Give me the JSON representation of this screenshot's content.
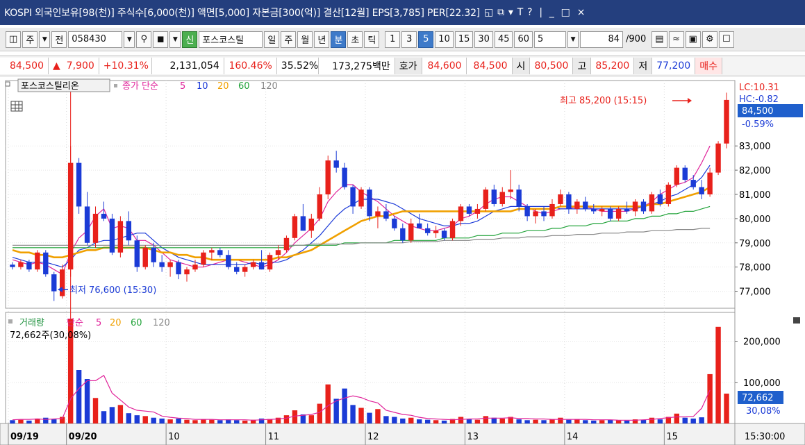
{
  "titlebar": {
    "title": "KOSPI 외국인보유[98(천)] 주식수[6,000(천)] 액면[5,000] 자본금[300(억)] 결산[12월] EPS[3,785] PER[22.32]",
    "icons": [
      "◱",
      "⧉",
      "▾",
      "T",
      "?"
    ],
    "win_buttons": [
      "|",
      "_",
      "□",
      "×"
    ]
  },
  "toolbar": {
    "market": "주",
    "period_mode": "전",
    "code": "058430",
    "name_tag": "신",
    "name": "포스코스틸",
    "periods": [
      "일",
      "주",
      "월",
      "년",
      "분",
      "초",
      "틱"
    ],
    "selected_period": "분",
    "intervals": [
      "1",
      "3",
      "5",
      "10",
      "15",
      "30",
      "45",
      "60"
    ],
    "selected_interval": "5",
    "interval_input": "5",
    "count": "84",
    "count_total": "/900"
  },
  "quote": {
    "price": "84,500",
    "change": "7,900",
    "change_pct": "+10.31%",
    "volume": "2,131,054",
    "volume_ratio": "160.46%",
    "turnover": "35.52%",
    "amount": "173,275백만",
    "bid_label": "호가",
    "bid": "84,600",
    "ask": "84,500",
    "open_label": "시",
    "open": "80,500",
    "high_label": "고",
    "high": "85,200",
    "low_label": "저",
    "low": "77,200",
    "buy_label": "매수"
  },
  "price_panel": {
    "stock_label": "포스코스틸리온",
    "ma_title": "종가 단순",
    "ma_periods": [
      "5",
      "10",
      "20",
      "60",
      "120"
    ],
    "ma_colors": [
      "#e0239a",
      "#1a39d8",
      "#f0a000",
      "#22a33a",
      "#888888"
    ],
    "lc": "LC:10.31",
    "hc": "HC:-0.82",
    "last_price": "84,500",
    "last_pct": "-0.59%",
    "y_ticks": [
      "83,000",
      "82,000",
      "81,000",
      "80,000",
      "79,000",
      "78,000",
      "77,000"
    ],
    "max_label": "최고 85,200 (15:15)",
    "min_label": "최저 76,600 (15:30)"
  },
  "volume_panel": {
    "title": "거래량",
    "ma_title": "단순",
    "ma_periods": [
      "5",
      "20",
      "60",
      "120"
    ],
    "info": "72,662주(30,08%)",
    "y_ticks": [
      "200,000",
      "100,000"
    ],
    "last_volume": "72,662",
    "last_pct": "30,08%"
  },
  "x_axis": {
    "labels": [
      "09/19",
      "09/20",
      "10",
      "11",
      "12",
      "13",
      "14",
      "15"
    ],
    "time": "15:30:00"
  },
  "chart_data": {
    "type": "candlestick",
    "up_color": "#e8211b",
    "down_color": "#1b3bd6",
    "price_range": [
      76300,
      85700
    ],
    "volume_range": [
      0,
      260000
    ],
    "sessions": [
      "09/19",
      "09/20",
      "10",
      "11",
      "12",
      "13",
      "14",
      "15"
    ],
    "ohlc": [
      [
        78100,
        78200,
        77900,
        78000
      ],
      [
        78000,
        78300,
        77900,
        78200
      ],
      [
        78200,
        78300,
        77800,
        77900
      ],
      [
        77900,
        78700,
        77800,
        78600
      ],
      [
        78600,
        78700,
        77600,
        77700
      ],
      [
        77700,
        77800,
        76600,
        77000
      ],
      [
        76800,
        78100,
        76700,
        77900
      ],
      [
        77900,
        83000,
        77600,
        82300
      ],
      [
        82300,
        82500,
        80200,
        80500
      ],
      [
        80500,
        81100,
        78900,
        79000
      ],
      [
        79000,
        80500,
        78800,
        80200
      ],
      [
        80200,
        80700,
        79900,
        80000
      ],
      [
        80000,
        80200,
        78500,
        78600
      ],
      [
        78600,
        80100,
        78400,
        79900
      ],
      [
        79900,
        80300,
        78900,
        79100
      ],
      [
        79100,
        79300,
        77800,
        78000
      ],
      [
        78000,
        78900,
        77900,
        78800
      ],
      [
        78800,
        79000,
        78000,
        78200
      ],
      [
        78200,
        78500,
        77800,
        78000
      ],
      [
        78000,
        78300,
        77600,
        78200
      ],
      [
        78200,
        78300,
        77500,
        77700
      ],
      [
        77700,
        78000,
        77400,
        77900
      ],
      [
        77900,
        78300,
        77800,
        78100
      ],
      [
        78100,
        78700,
        78000,
        78600
      ],
      [
        78600,
        78800,
        78300,
        78700
      ],
      [
        78700,
        78800,
        78400,
        78500
      ],
      [
        78500,
        78700,
        77900,
        78000
      ],
      [
        78000,
        78200,
        77700,
        77800
      ],
      [
        77800,
        78100,
        77600,
        78000
      ],
      [
        78000,
        78300,
        77900,
        78200
      ],
      [
        78200,
        78700,
        77900,
        77900
      ],
      [
        77900,
        78600,
        77800,
        78500
      ],
      [
        78500,
        78900,
        78300,
        78700
      ],
      [
        78700,
        79300,
        78600,
        79200
      ],
      [
        79200,
        80200,
        79100,
        80100
      ],
      [
        80100,
        80600,
        79500,
        79500
      ],
      [
        79500,
        80200,
        79200,
        80000
      ],
      [
        80000,
        81300,
        79900,
        81000
      ],
      [
        81000,
        82600,
        80800,
        82400
      ],
      [
        82400,
        82800,
        81900,
        82100
      ],
      [
        82100,
        82300,
        81200,
        81300
      ],
      [
        81300,
        81400,
        80200,
        80500
      ],
      [
        80500,
        81300,
        80400,
        81200
      ],
      [
        81200,
        81300,
        79900,
        80100
      ],
      [
        80100,
        80500,
        79600,
        80300
      ],
      [
        80300,
        80600,
        79900,
        80000
      ],
      [
        80000,
        80100,
        79500,
        79600
      ],
      [
        79600,
        79800,
        79000,
        79100
      ],
      [
        79100,
        80000,
        79000,
        79800
      ],
      [
        79800,
        80200,
        79600,
        79600
      ],
      [
        79600,
        79800,
        79300,
        79400
      ],
      [
        79400,
        79700,
        79200,
        79500
      ],
      [
        79500,
        79600,
        79100,
        79200
      ],
      [
        79200,
        80000,
        79100,
        79900
      ],
      [
        79900,
        80600,
        79700,
        80500
      ],
      [
        80500,
        80600,
        80100,
        80200
      ],
      [
        80200,
        80600,
        80000,
        80400
      ],
      [
        80400,
        81300,
        80300,
        81200
      ],
      [
        81200,
        81400,
        80500,
        80600
      ],
      [
        80600,
        81300,
        80500,
        81100
      ],
      [
        81100,
        82000,
        80800,
        81200
      ],
      [
        81200,
        81400,
        80300,
        80500
      ],
      [
        80500,
        80600,
        79900,
        80100
      ],
      [
        80100,
        80400,
        79800,
        80300
      ],
      [
        80300,
        80500,
        79900,
        80100
      ],
      [
        80100,
        80800,
        80000,
        80600
      ],
      [
        80600,
        81200,
        80500,
        81000
      ],
      [
        81000,
        81100,
        80200,
        80400
      ],
      [
        80400,
        80800,
        80200,
        80700
      ],
      [
        80700,
        80900,
        80300,
        80400
      ],
      [
        80400,
        80600,
        80200,
        80300
      ],
      [
        80300,
        80500,
        80100,
        80400
      ],
      [
        80400,
        80500,
        79900,
        80000
      ],
      [
        80000,
        80500,
        79900,
        80400
      ],
      [
        80400,
        80700,
        80200,
        80300
      ],
      [
        80300,
        80800,
        80100,
        80700
      ],
      [
        80700,
        80800,
        80200,
        80300
      ],
      [
        80300,
        81100,
        80200,
        81000
      ],
      [
        81000,
        81200,
        80500,
        80600
      ],
      [
        80600,
        81500,
        80500,
        81400
      ],
      [
        81400,
        82200,
        81300,
        82100
      ],
      [
        82100,
        82200,
        81500,
        81600
      ],
      [
        81600,
        81800,
        81200,
        81300
      ],
      [
        81300,
        81600,
        80800,
        81000
      ],
      [
        81000,
        82100,
        80900,
        81900
      ],
      [
        81900,
        83200,
        81800,
        83100
      ],
      [
        83100,
        85200,
        82900,
        84900
      ]
    ],
    "volume": [
      8000,
      9000,
      7000,
      12000,
      14000,
      10000,
      16000,
      255000,
      130000,
      108000,
      62000,
      30000,
      40000,
      45000,
      25000,
      20000,
      18000,
      14000,
      12000,
      10000,
      12000,
      9000,
      8000,
      10000,
      9000,
      8000,
      10000,
      8000,
      7000,
      9000,
      12000,
      11000,
      14000,
      20000,
      32000,
      22000,
      20000,
      48000,
      95000,
      60000,
      85000,
      45000,
      38000,
      26000,
      35000,
      18000,
      16000,
      12000,
      14000,
      10000,
      9000,
      8000,
      7000,
      11000,
      16000,
      10000,
      9000,
      18000,
      14000,
      12000,
      16000,
      10000,
      8000,
      9000,
      8000,
      10000,
      14000,
      9000,
      11000,
      8000,
      7000,
      8000,
      9000,
      8000,
      7000,
      10000,
      9000,
      14000,
      10000,
      16000,
      24000,
      14000,
      12000,
      15000,
      120000,
      235000,
      72662
    ],
    "ma_lines": {
      "5": [
        78300,
        78200,
        78100,
        78200,
        78100,
        77900,
        77700,
        78600,
        79200,
        79500,
        80100,
        80400,
        79600,
        79700,
        79600,
        79100,
        79100,
        78900,
        78600,
        78300,
        78200,
        78100,
        78000,
        78000,
        78100,
        78200,
        78300,
        78300,
        78200,
        78100,
        78000,
        78100,
        78300,
        78600,
        79000,
        79300,
        79600,
        80000,
        80700,
        81100,
        81400,
        81400,
        81100,
        80900,
        80700,
        80400,
        80100,
        79900,
        79700,
        79600,
        79500,
        79500,
        79600,
        79700,
        80000,
        80100,
        80300,
        80600,
        80800,
        80900,
        80900,
        80700,
        80500,
        80300,
        80200,
        80300,
        80400,
        80400,
        80500,
        80500,
        80400,
        80300,
        80300,
        80300,
        80300,
        80400,
        80500,
        80700,
        81000,
        81200,
        81400,
        81500,
        81700,
        82300,
        83000
      ],
      "10": [
        78400,
        78300,
        78200,
        78200,
        78200,
        78100,
        78000,
        78300,
        78700,
        78800,
        79000,
        79100,
        79100,
        79200,
        79300,
        79400,
        79400,
        79100,
        78800,
        78600,
        78400,
        78300,
        78200,
        78100,
        78100,
        78100,
        78100,
        78100,
        78100,
        78200,
        78100,
        78200,
        78200,
        78300,
        78500,
        78700,
        79000,
        79300,
        79700,
        80100,
        80400,
        80600,
        80800,
        80800,
        80800,
        80700,
        80600,
        80400,
        80200,
        80000,
        79900,
        79800,
        79700,
        79700,
        79800,
        79800,
        79900,
        80100,
        80300,
        80400,
        80500,
        80500,
        80500,
        80500,
        80500,
        80500,
        80400,
        80400,
        80400,
        80400,
        80400,
        80400,
        80400,
        80400,
        80400,
        80400,
        80500,
        80600,
        80700,
        80900,
        81000,
        81200,
        81400,
        81700,
        82200
      ],
      "20": [
        78700,
        78600,
        78600,
        78500,
        78500,
        78400,
        78400,
        78500,
        78600,
        78700,
        78700,
        78800,
        78800,
        78800,
        78800,
        78800,
        78800,
        78700,
        78600,
        78600,
        78500,
        78500,
        78400,
        78400,
        78300,
        78300,
        78300,
        78300,
        78300,
        78300,
        78300,
        78300,
        78400,
        78400,
        78500,
        78600,
        78700,
        78900,
        79100,
        79300,
        79500,
        79700,
        79900,
        80000,
        80100,
        80100,
        80200,
        80300,
        80300,
        80300,
        80300,
        80300,
        80300,
        80300,
        80300,
        80300,
        80300,
        80300,
        80300,
        80300,
        80300,
        80400,
        80400,
        80400,
        80400,
        80400,
        80500,
        80500,
        80500,
        80500,
        80500,
        80500,
        80500,
        80500,
        80500,
        80500,
        80500,
        80600,
        80600,
        80700,
        80800,
        80900,
        81000,
        81100,
        81300
      ],
      "60": [
        78800,
        78800,
        78800,
        78800,
        78800,
        78800,
        78800,
        78800,
        78800,
        78800,
        78800,
        78800,
        78800,
        78800,
        78800,
        78800,
        78800,
        78800,
        78800,
        78800,
        78800,
        78800,
        78800,
        78800,
        78800,
        78800,
        78800,
        78800,
        78800,
        78800,
        78800,
        78800,
        78800,
        78800,
        78900,
        78900,
        78900,
        78900,
        78900,
        78900,
        79000,
        79000,
        79000,
        79000,
        79000,
        79000,
        79100,
        79100,
        79100,
        79100,
        79100,
        79100,
        79200,
        79200,
        79200,
        79200,
        79300,
        79300,
        79300,
        79400,
        79400,
        79400,
        79500,
        79500,
        79500,
        79600,
        79600,
        79700,
        79700,
        79700,
        79800,
        79800,
        79900,
        79900,
        79900,
        80000,
        80000,
        80100,
        80100,
        80200,
        80200,
        80300,
        80300,
        80400,
        80500
      ],
      "120": [
        78900,
        78900,
        78900,
        78900,
        78900,
        78900,
        78900,
        78900,
        78900,
        78900,
        78900,
        78900,
        78900,
        78900,
        78900,
        78900,
        78900,
        78900,
        78900,
        78900,
        78900,
        78900,
        78900,
        78900,
        78900,
        78900,
        78900,
        78900,
        78900,
        78900,
        78900,
        78900,
        78900,
        78900,
        78900,
        78900,
        78950,
        78950,
        78950,
        78950,
        78950,
        78950,
        79000,
        79000,
        79000,
        79000,
        79000,
        79000,
        79050,
        79050,
        79050,
        79050,
        79100,
        79100,
        79100,
        79100,
        79150,
        79150,
        79150,
        79200,
        79200,
        79200,
        79250,
        79250,
        79250,
        79300,
        79300,
        79300,
        79350,
        79350,
        79350,
        79400,
        79400,
        79400,
        79450,
        79450,
        79450,
        79500,
        79500,
        79500,
        79550,
        79550,
        79550,
        79600,
        79600
      ]
    },
    "vol_ma5": [
      9000,
      10000,
      10000,
      11000,
      10000,
      11000,
      12000,
      60000,
      85000,
      104000,
      104000,
      117000,
      74000,
      57000,
      40000,
      32000,
      30000,
      28000,
      18000,
      15000,
      13000,
      12000,
      10000,
      10000,
      10000,
      9000,
      9000,
      9000,
      9000,
      8000,
      9000,
      10000,
      11000,
      13000,
      18000,
      20000,
      22000,
      27000,
      43000,
      55000,
      62000,
      67000,
      63000,
      55000,
      50000,
      32000,
      27000,
      22000,
      20000,
      15000,
      12000,
      11000,
      10000,
      9000,
      10000,
      11000,
      11000,
      13000,
      13000,
      13000,
      14000,
      12000,
      12000,
      11000,
      11000,
      10000,
      10000,
      10000,
      10000,
      10000,
      9000,
      9000,
      9000,
      8000,
      8000,
      8000,
      9000,
      10000,
      12000,
      14000,
      16000,
      16000,
      17000,
      37000,
      81000
    ]
  }
}
